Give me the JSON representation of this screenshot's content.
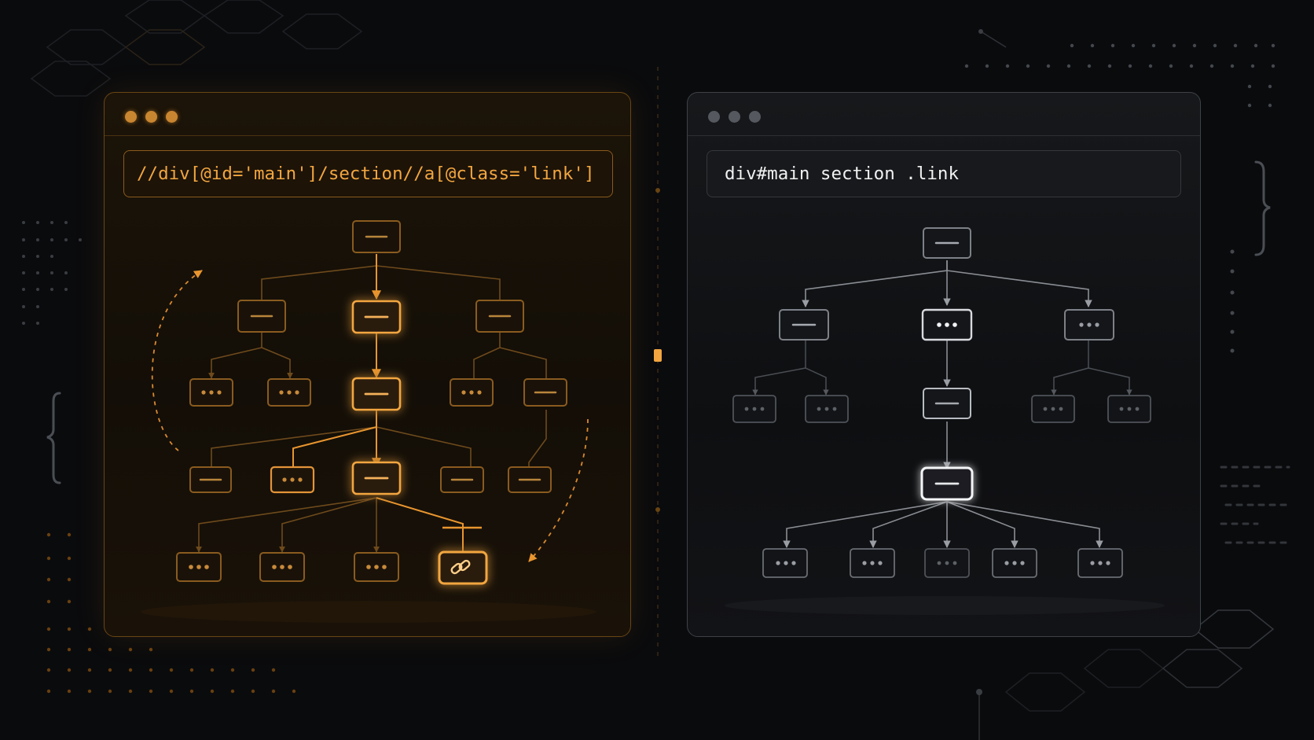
{
  "left_window": {
    "query": "//div[@id='main']/section//a[@class='link']",
    "accent": "#f2a640"
  },
  "right_window": {
    "query": "div#main section .link",
    "accent": "#f1f1f1"
  },
  "icons": {
    "collapsed_node": "dash-icon",
    "expandable_node": "ellipsis-icon",
    "target_node": "link-icon",
    "cycle_arrows": "curved-arrow-icon"
  }
}
